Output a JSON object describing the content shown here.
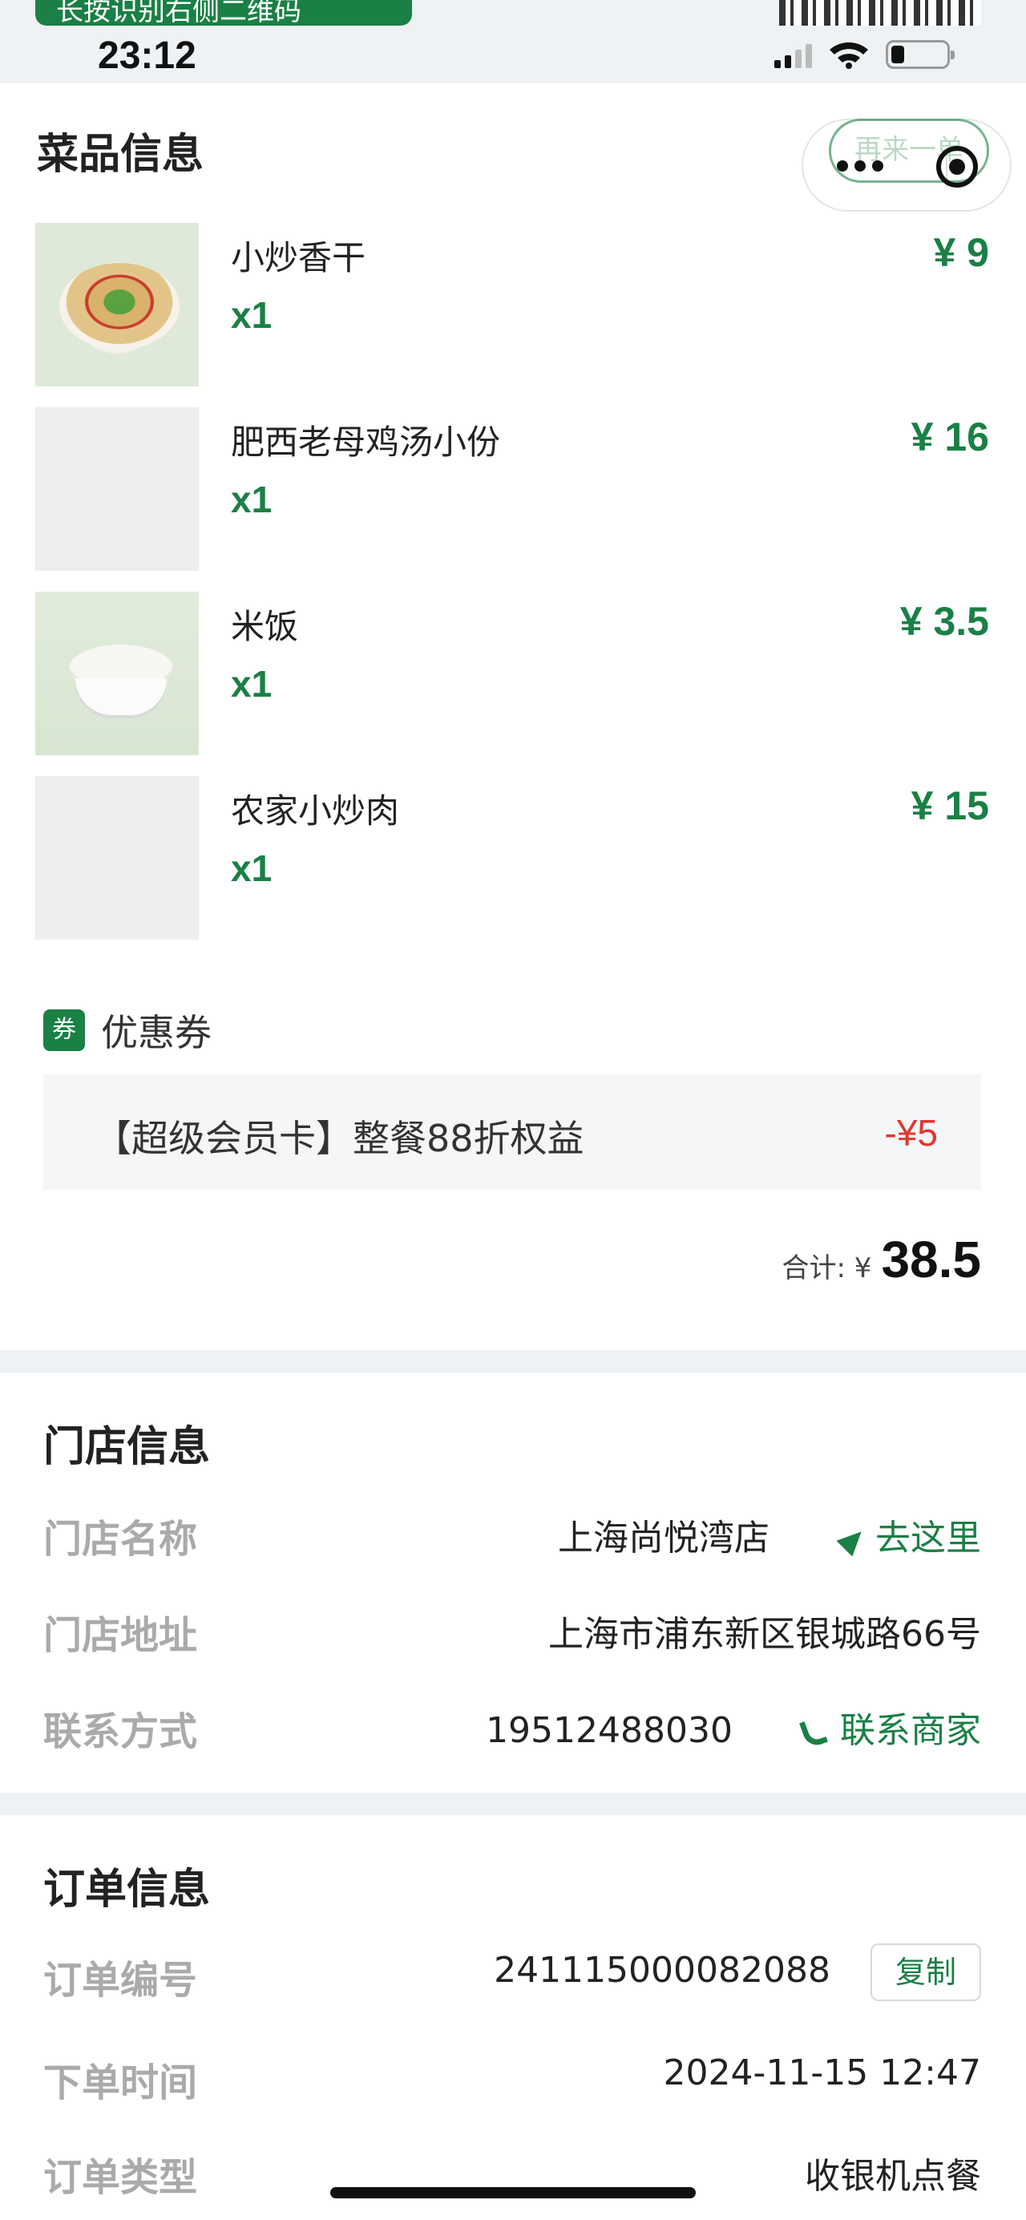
{
  "banner": {
    "text": "长按识别右侧二维码"
  },
  "status_bar": {
    "time": "23:12"
  },
  "menu_section": {
    "title": "菜品信息",
    "reorder_label": "再来一单",
    "items": [
      {
        "name": "小炒香干",
        "qty": "x1",
        "price": "¥ 9",
        "image": "stir-fried-tofu"
      },
      {
        "name": "肥西老母鸡汤小份",
        "qty": "x1",
        "price": "¥ 16",
        "image": ""
      },
      {
        "name": "米饭",
        "qty": "x1",
        "price": "¥ 3.5",
        "image": "rice"
      },
      {
        "name": "农家小炒肉",
        "qty": "x1",
        "price": "¥ 15",
        "image": ""
      }
    ],
    "coupon": {
      "tag": "券",
      "label": "优惠券",
      "name": "【超级会员卡】整餐88折权益",
      "discount": "-¥5"
    },
    "total": {
      "label": "合计: ¥",
      "value": "38.5"
    }
  },
  "store_section": {
    "title": "门店信息",
    "name_label": "门店名称",
    "name_value": "上海尚悦湾店",
    "go_label": "去这里",
    "address_label": "门店地址",
    "address_value": "上海市浦东新区银城路66号",
    "contact_label": "联系方式",
    "contact_value": "19512488030",
    "call_label": "联系商家"
  },
  "order_section": {
    "title": "订单信息",
    "number_label": "订单编号",
    "number_value": "241115000082088",
    "copy_label": "复制",
    "time_label": "下单时间",
    "time_value": "2024-11-15 12:47",
    "type_label": "订单类型",
    "type_value": "收银机点餐"
  },
  "colors": {
    "accent": "#1a8045",
    "discount": "#e0382e",
    "divider": "#eef2f4"
  }
}
